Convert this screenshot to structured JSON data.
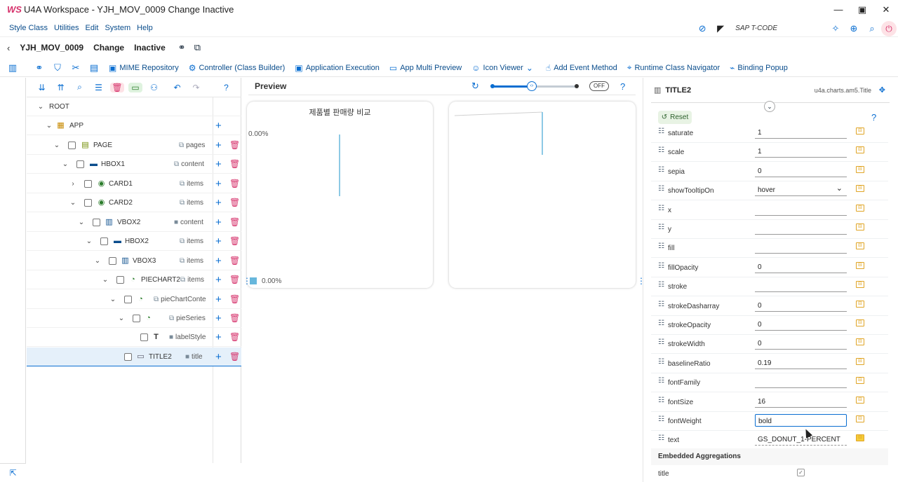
{
  "window": {
    "title": "U4A Workspace - YJH_MOV_0009 Change Inactive",
    "logo_text": "WS"
  },
  "menu": {
    "items": [
      "Style Class",
      "Utilities",
      "Edit",
      "System",
      "Help"
    ],
    "tcode_label": "SAP T-CODE"
  },
  "header": {
    "app_name": "YJH_MOV_0009",
    "mode": "Change",
    "status": "Inactive"
  },
  "toolbar": {
    "buttons": [
      "MIME Repository",
      "Controller (Class Builder)",
      "Application Execution",
      "App Multi Preview",
      "Icon Viewer",
      "Add Event Method",
      "Runtime Class Navigator",
      "Binding Popup"
    ]
  },
  "tree": {
    "rows": [
      {
        "label": "ROOT",
        "agg": ""
      },
      {
        "label": "APP",
        "agg": ""
      },
      {
        "label": "PAGE",
        "agg": "pages"
      },
      {
        "label": "HBOX1",
        "agg": "content"
      },
      {
        "label": "CARD1",
        "agg": "items"
      },
      {
        "label": "CARD2",
        "agg": "items"
      },
      {
        "label": "VBOX2",
        "agg": "content"
      },
      {
        "label": "HBOX2",
        "agg": "items"
      },
      {
        "label": "VBOX3",
        "agg": "items"
      },
      {
        "label": "PIECHART2",
        "agg": "items"
      },
      {
        "label": "",
        "agg": "pieChartConte"
      },
      {
        "label": "",
        "agg": "pieSeries"
      },
      {
        "label": "",
        "agg": "labelStyle"
      },
      {
        "label": "TITLE2",
        "agg": "title"
      }
    ]
  },
  "preview": {
    "title": "Preview",
    "toggle_label": "OFF",
    "card1_title": "제품별 판매량 비교",
    "card1_pct_top": "0.00%",
    "card1_pct_bottom": "0.00%"
  },
  "properties": {
    "object_name": "TITLE2",
    "class_name": "u4a.charts.am5.Title",
    "reset_label": "Reset",
    "rows": [
      {
        "name": "saturate",
        "value": "1"
      },
      {
        "name": "scale",
        "value": "1"
      },
      {
        "name": "sepia",
        "value": "0"
      },
      {
        "name": "showTooltipOn",
        "value": "hover"
      },
      {
        "name": "x",
        "value": ""
      },
      {
        "name": "y",
        "value": ""
      },
      {
        "name": "fill",
        "value": ""
      },
      {
        "name": "fillOpacity",
        "value": "0"
      },
      {
        "name": "stroke",
        "value": ""
      },
      {
        "name": "strokeDasharray",
        "value": "0"
      },
      {
        "name": "strokeOpacity",
        "value": "0"
      },
      {
        "name": "strokeWidth",
        "value": "0"
      },
      {
        "name": "baselineRatio",
        "value": "0.19"
      },
      {
        "name": "fontFamily",
        "value": ""
      },
      {
        "name": "fontSize",
        "value": "16"
      },
      {
        "name": "fontWeight",
        "value": "bold"
      },
      {
        "name": "text",
        "value": "GS_DONUT_1-PERCENT"
      }
    ],
    "embedded_title": "Embedded Aggregations",
    "embedded_row": "title"
  },
  "colors": {
    "accent": "#0a6ed1",
    "delete": "#d6336c",
    "legend": "#67b7dc"
  }
}
